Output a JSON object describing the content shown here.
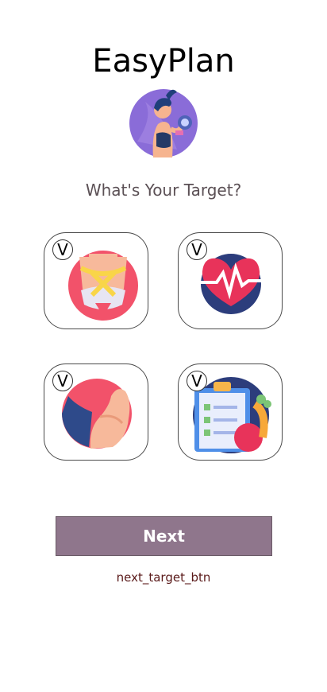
{
  "app": {
    "title": "EasyPlan"
  },
  "header": {
    "subtitle": "What's Your Target?"
  },
  "targets": [
    {
      "name": "waist-measure",
      "check_label": "V",
      "icon": "waist-tape-icon"
    },
    {
      "name": "heart-health",
      "check_label": "V",
      "icon": "heartbeat-icon"
    },
    {
      "name": "muscle",
      "check_label": "V",
      "icon": "flexed-arm-icon"
    },
    {
      "name": "diet-plan",
      "check_label": "V",
      "icon": "checklist-vegetables-icon"
    }
  ],
  "actions": {
    "next_label": "Next",
    "next_id_text": "next_target_btn"
  },
  "colors": {
    "button": "#8f768c",
    "id_text": "#5a1a1a",
    "subtitle": "#5b5055"
  }
}
